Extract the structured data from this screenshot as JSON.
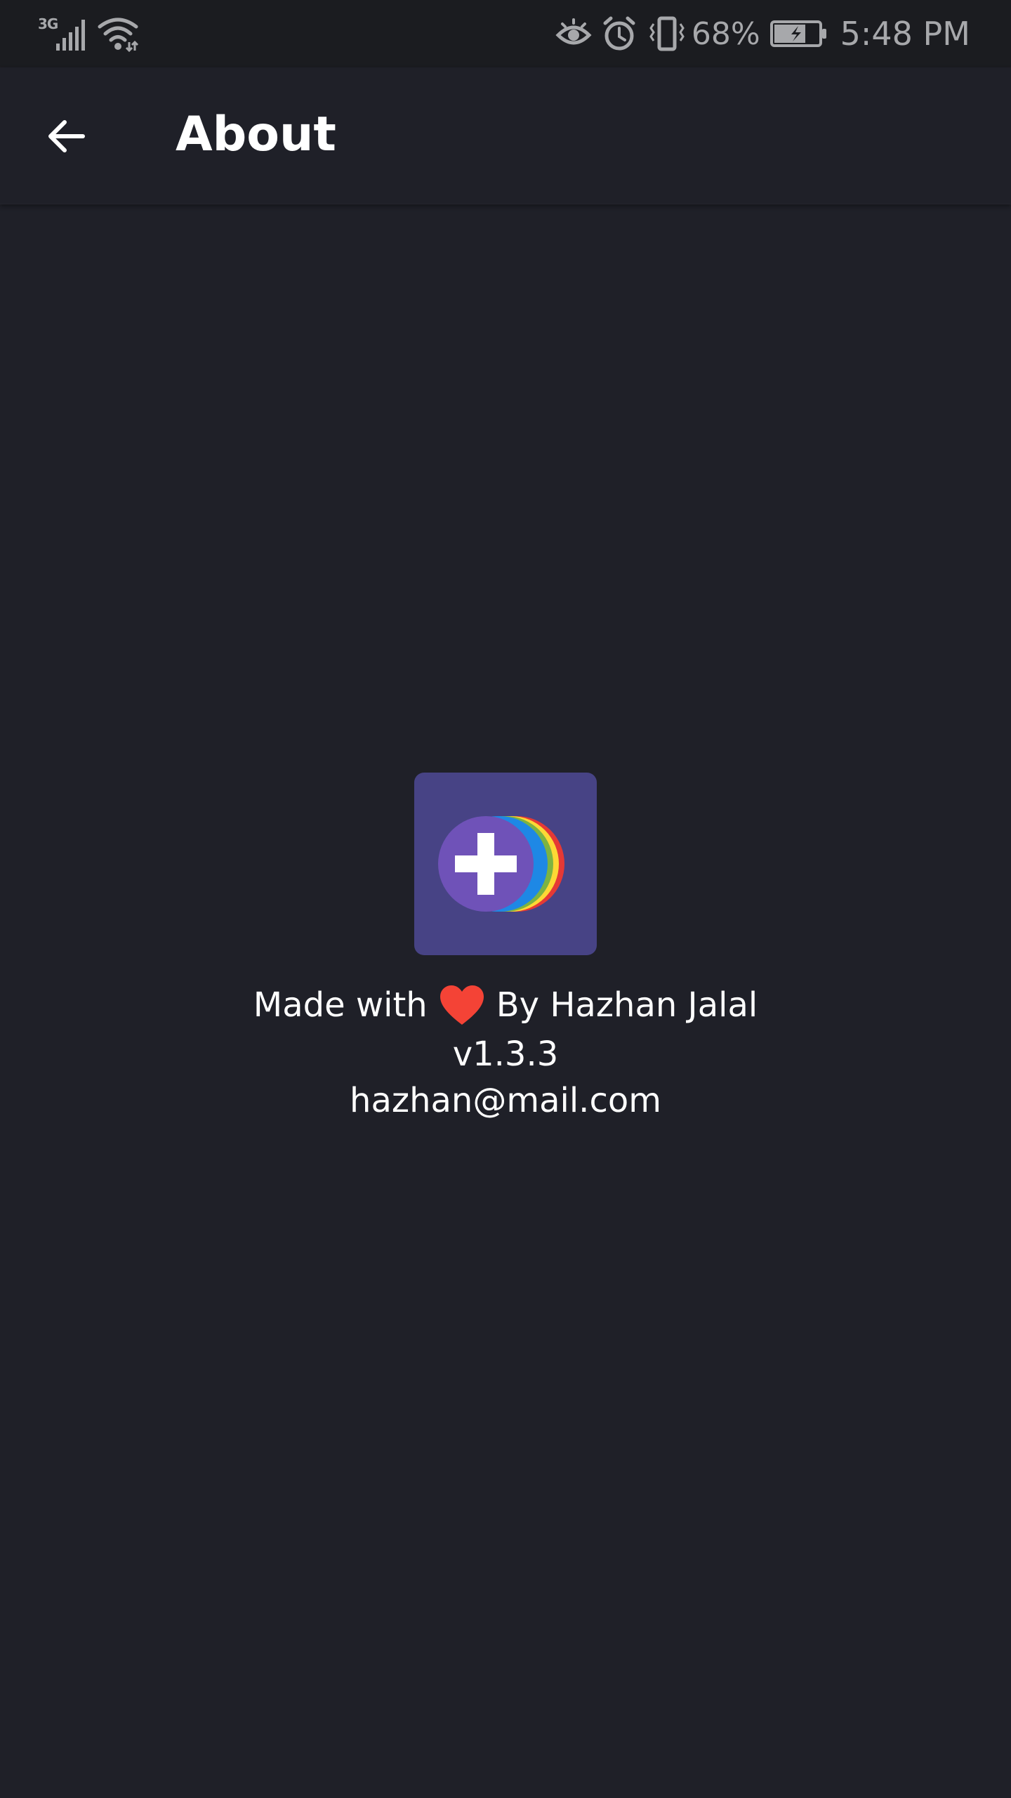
{
  "status_bar": {
    "network_type": "3G",
    "battery_percent": "68%",
    "time": "5:48 PM",
    "icons": [
      "signal-icon",
      "wifi-icon",
      "eye-icon",
      "alarm-icon",
      "vibrate-icon",
      "battery-icon"
    ]
  },
  "app_bar": {
    "back_icon": "arrow-back-icon",
    "title": "About"
  },
  "about": {
    "logo_icon": "app-logo-plus-rainbow",
    "credit_prefix": "Made with",
    "heart_icon": "heart-icon",
    "credit_suffix": "By Hazhan Jalal",
    "version": "v1.3.3",
    "email": "hazhan@mail.com"
  },
  "colors": {
    "background": "#1f2028",
    "status_bar_bg": "#1b1c20",
    "logo_bg": "#474385",
    "logo_circle": "#6f52b8",
    "heart": "#f44336",
    "text": "#ffffff"
  }
}
